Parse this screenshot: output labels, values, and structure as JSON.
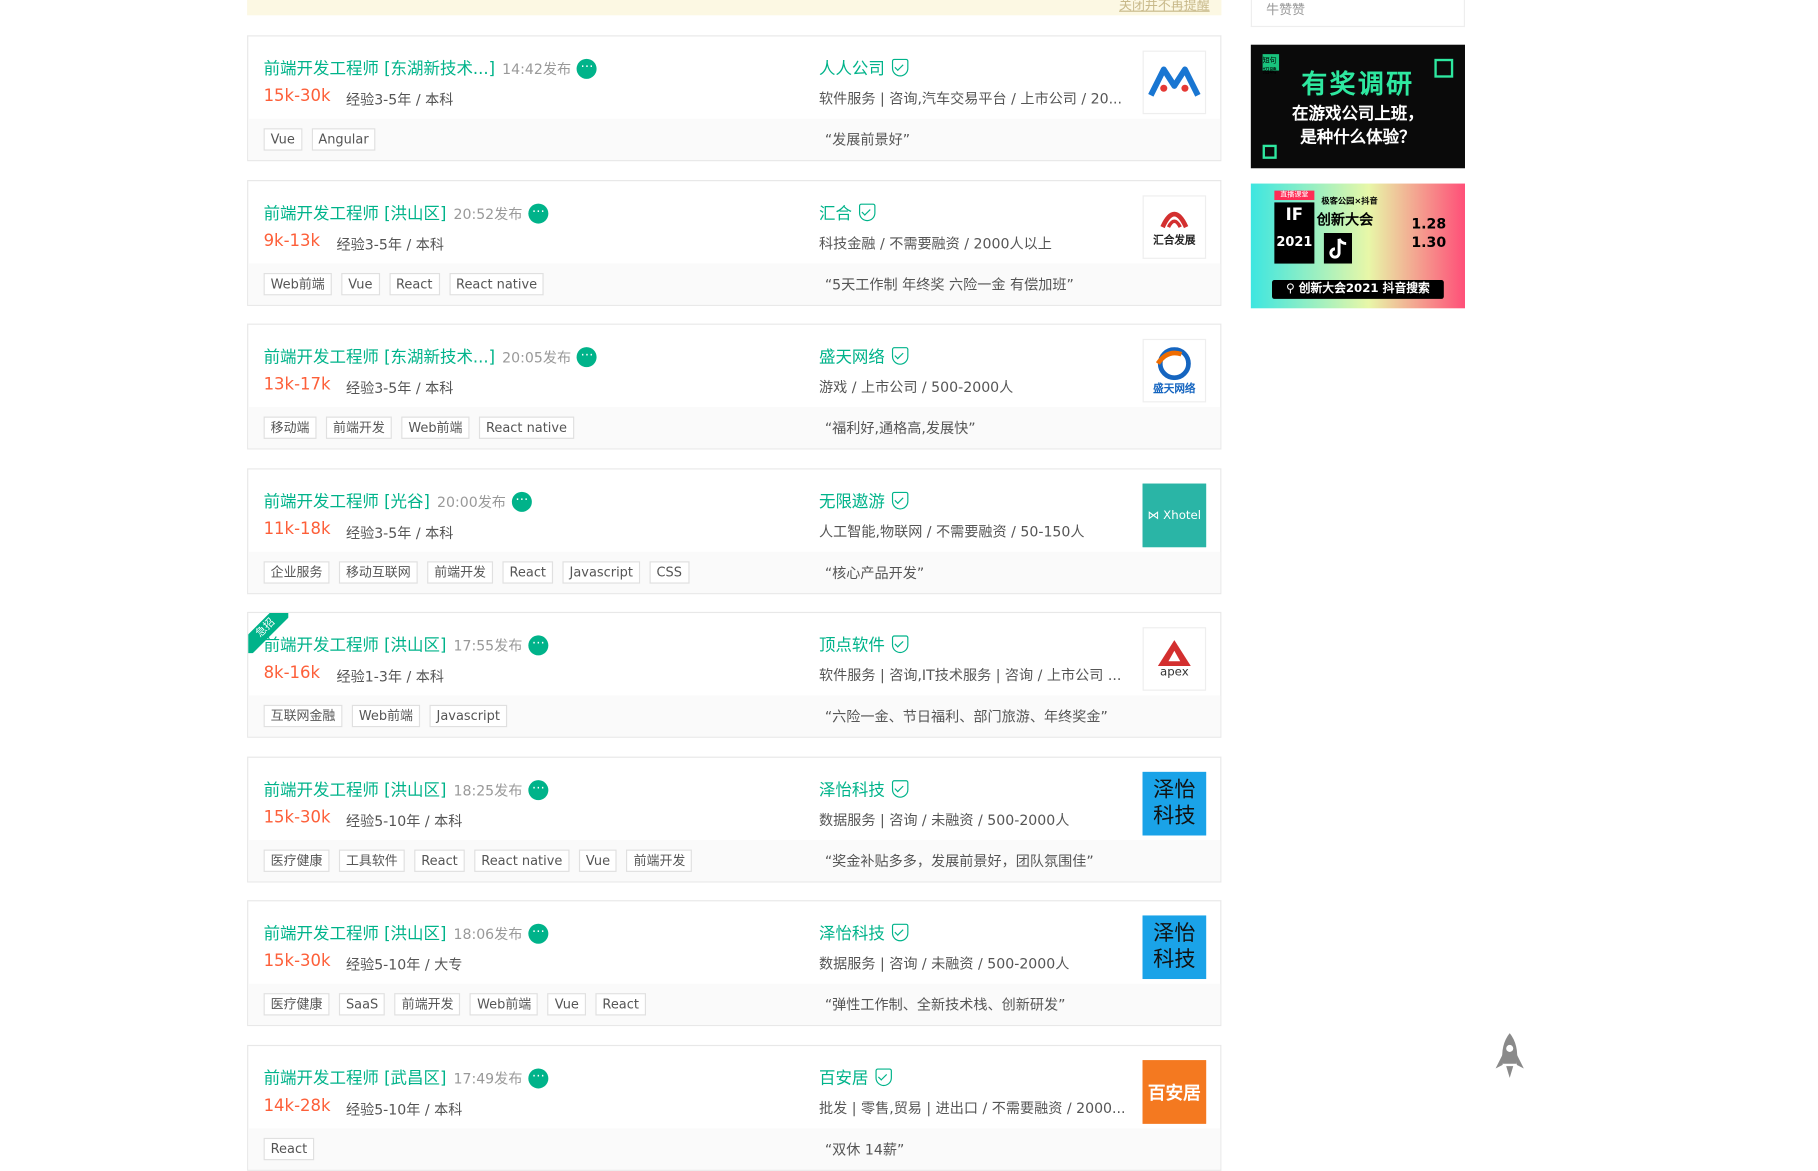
{
  "notice": {
    "close_link": "关闭并不再提醒"
  },
  "sidebar": {
    "top_label": "牛赞赞",
    "ad1": {
      "corner": "短句招聘",
      "headline": "有奖调研",
      "line1": "在游戏公司上班，",
      "line2": "是种什么体验？"
    },
    "ad2": {
      "top_tag": "直播课堂",
      "subtitle": "极客公园×抖音",
      "title": "创新大会",
      "if_text": "IF",
      "year": "2021",
      "date1": "1.28",
      "date2": "1.30",
      "search_bar": "创新大会2021 抖音搜索"
    }
  },
  "jobs": [
    {
      "title": "前端开发工程师 [东湖新技术...]",
      "time": "14:42发布",
      "salary": "15k-30k",
      "req": "经验3-5年 / 本科",
      "company": "人人公司",
      "industry": "软件服务 | 咨询,汽车交易平台 / 上市公司 / 20...",
      "tags": [
        "Vue",
        "Angular"
      ],
      "slogan": "“发展前景好”",
      "logo_text": "",
      "corner": ""
    },
    {
      "title": "前端开发工程师 [洪山区]",
      "time": "20:52发布",
      "salary": "9k-13k",
      "req": "经验3-5年 / 本科",
      "company": "汇合",
      "industry": "科技金融 / 不需要融资 / 2000人以上",
      "tags": [
        "Web前端",
        "Vue",
        "React",
        "React native"
      ],
      "slogan": "“5天工作制 年终奖 六险一金 有偿加班”",
      "logo_text": "汇合发展",
      "corner": ""
    },
    {
      "title": "前端开发工程师 [东湖新技术...]",
      "time": "20:05发布",
      "salary": "13k-17k",
      "req": "经验3-5年 / 本科",
      "company": "盛天网络",
      "industry": "游戏 / 上市公司 / 500-2000人",
      "tags": [
        "移动端",
        "前端开发",
        "Web前端",
        "React native"
      ],
      "slogan": "“福利好,通格高,发展快”",
      "logo_text": "盛天网络",
      "corner": ""
    },
    {
      "title": "前端开发工程师 [光谷]",
      "time": "20:00发布",
      "salary": "11k-18k",
      "req": "经验3-5年 / 本科",
      "company": "无限遨游",
      "industry": "人工智能,物联网 / 不需要融资 / 50-150人",
      "tags": [
        "企业服务",
        "移动互联网",
        "前端开发",
        "React",
        "Javascript",
        "CSS"
      ],
      "slogan": "“核心产品开发”",
      "logo_text": "⋈ Xhotel",
      "corner": ""
    },
    {
      "title": "前端开发工程师 [洪山区]",
      "time": "17:55发布",
      "salary": "8k-16k",
      "req": "经验1-3年 / 本科",
      "company": "顶点软件",
      "industry": "软件服务 | 咨询,IT技术服务 | 咨询 / 上市公司 ...",
      "tags": [
        "互联网金融",
        "Web前端",
        "Javascript"
      ],
      "slogan": "“六险一金、节日福利、部门旅游、年终奖金”",
      "logo_text": "apex",
      "corner": "急招"
    },
    {
      "title": "前端开发工程师 [洪山区]",
      "time": "18:25发布",
      "salary": "15k-30k",
      "req": "经验5-10年 / 本科",
      "company": "泽怡科技",
      "industry": "数据服务 | 咨询 / 未融资 / 500-2000人",
      "tags": [
        "医疗健康",
        "工具软件",
        "React",
        "React native",
        "Vue",
        "前端开发"
      ],
      "slogan": "“奖金补贴多多，发展前景好，团队氛围佳”",
      "logo_text": "泽怡科技",
      "corner": ""
    },
    {
      "title": "前端开发工程师 [洪山区]",
      "time": "18:06发布",
      "salary": "15k-30k",
      "req": "经验5-10年 / 大专",
      "company": "泽怡科技",
      "industry": "数据服务 | 咨询 / 未融资 / 500-2000人",
      "tags": [
        "医疗健康",
        "SaaS",
        "前端开发",
        "Web前端",
        "Vue",
        "React"
      ],
      "slogan": "“弹性工作制、全新技术栈、创新研发”",
      "logo_text": "泽怡科技",
      "corner": ""
    },
    {
      "title": "前端开发工程师 [武昌区]",
      "time": "17:49发布",
      "salary": "14k-28k",
      "req": "经验5-10年 / 本科",
      "company": "百安居",
      "industry": "批发 | 零售,贸易 | 进出口 / 不需要融资 / 2000...",
      "tags": [
        "React"
      ],
      "slogan": "“双休 14薪”",
      "logo_text": "百安居",
      "corner": ""
    }
  ],
  "colors": {
    "brand": "#00b38a",
    "salary": "#fd5f39",
    "zeyi_blue": "#1aa3e8",
    "xhotel_teal": "#2ab5a6",
    "baianju_orange": "#f47920"
  },
  "icons": {
    "chat": "chat-bubble-icon",
    "verify": "shield-check-icon",
    "back_to_top": "rocket-icon"
  }
}
